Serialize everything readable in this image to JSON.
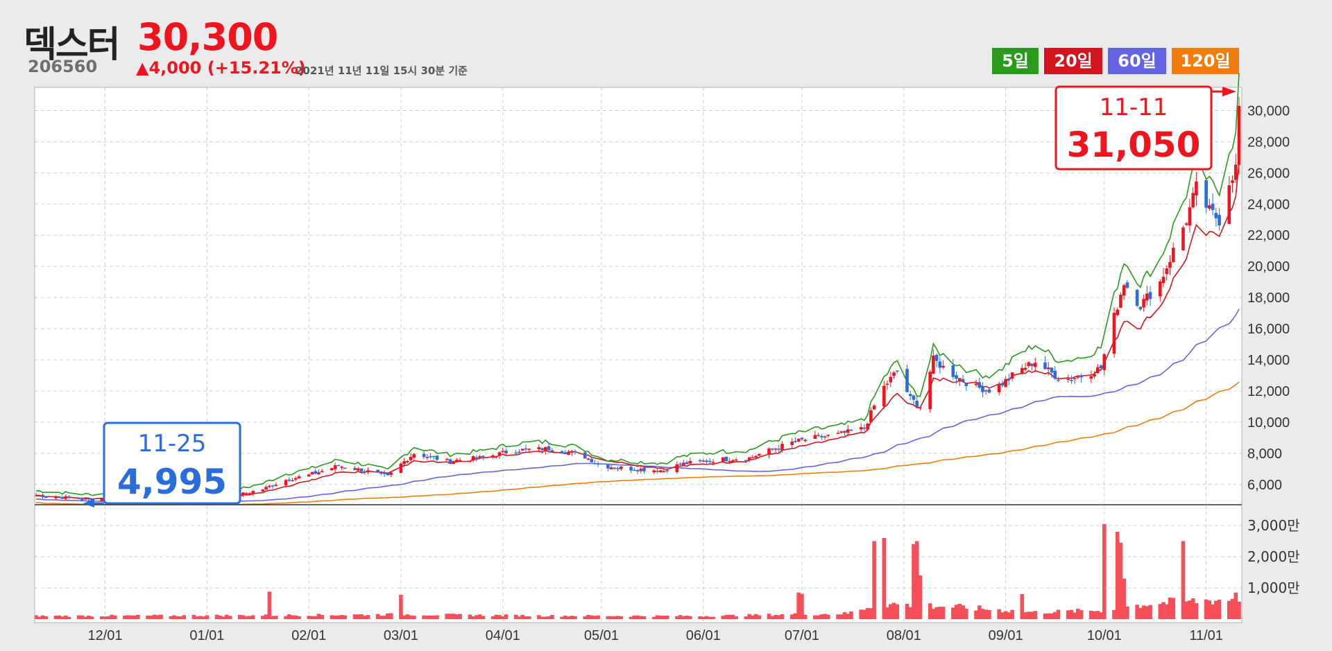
{
  "header": {
    "stock_name": "덱스터",
    "stock_code": "206560",
    "price": "30,300",
    "change": "▲4,000 (+15.21%)",
    "as_of": "2021년 11년 11일 15시 30분 기준"
  },
  "legend": [
    {
      "label": "5일",
      "color": "#2a9a1e"
    },
    {
      "label": "20일",
      "color": "#d4141e"
    },
    {
      "label": "60일",
      "color": "#6464e0"
    },
    {
      "label": "120일",
      "color": "#f07d0a"
    }
  ],
  "colors": {
    "up": "#f0141e",
    "down": "#2a6cdc",
    "volume": "#f5505a",
    "ma5": "#2a9a1e",
    "ma20": "#d4141e",
    "ma60": "#6464e0",
    "ma120": "#f07d0a"
  },
  "annotations": {
    "high": {
      "date": "11-11",
      "value": "31,050"
    },
    "low": {
      "date": "11-25",
      "value": "4,995"
    }
  },
  "chart_data": {
    "type": "candlestick",
    "price_axis": {
      "ticks": [
        6000,
        8000,
        10000,
        12000,
        14000,
        16000,
        18000,
        20000,
        22000,
        24000,
        26000,
        28000,
        30000
      ],
      "tick_labels": [
        "6,000",
        "8,000",
        "10,000",
        "12,000",
        "14,000",
        "16,000",
        "18,000",
        "20,000",
        "22,000",
        "24,000",
        "26,000",
        "28,000",
        "30,000"
      ],
      "range": [
        4700,
        31400
      ]
    },
    "volume_axis": {
      "ticks": [
        10000000,
        20000000,
        30000000
      ],
      "tick_labels": [
        "1,000만",
        "2,000만",
        "3,000만"
      ],
      "max": 34000000
    },
    "date_axis": {
      "start": "2020-11-10",
      "end": "2021-11-11",
      "ticks": [
        {
          "label": "12/01",
          "date": "2020-12-01"
        },
        {
          "label": "01/01",
          "date": "2021-01-01"
        },
        {
          "label": "02/01",
          "date": "2021-02-01"
        },
        {
          "label": "03/01",
          "date": "2021-03-01"
        },
        {
          "label": "04/01",
          "date": "2021-04-01"
        },
        {
          "label": "05/01",
          "date": "2021-05-01"
        },
        {
          "label": "06/01",
          "date": "2021-06-01"
        },
        {
          "label": "07/01",
          "date": "2021-07-01"
        },
        {
          "label": "08/01",
          "date": "2021-08-01"
        },
        {
          "label": "09/01",
          "date": "2021-09-01"
        },
        {
          "label": "10/01",
          "date": "2021-10-01"
        },
        {
          "label": "11/01",
          "date": "2021-11-01"
        }
      ]
    },
    "close_path": [
      [
        "2020-11-10",
        5300
      ],
      [
        "2020-11-25",
        5050
      ],
      [
        "2020-12-10",
        5150
      ],
      [
        "2020-12-28",
        5150
      ],
      [
        "2021-01-10",
        5300
      ],
      [
        "2021-01-18",
        5700
      ],
      [
        "2021-01-25",
        6300
      ],
      [
        "2021-02-01",
        6600
      ],
      [
        "2021-02-10",
        7200
      ],
      [
        "2021-02-20",
        6800
      ],
      [
        "2021-02-25",
        6500
      ],
      [
        "2021-03-01",
        7300
      ],
      [
        "2021-03-05",
        8000
      ],
      [
        "2021-03-15",
        7500
      ],
      [
        "2021-03-25",
        7700
      ],
      [
        "2021-04-05",
        8200
      ],
      [
        "2021-04-15",
        8300
      ],
      [
        "2021-04-25",
        7900
      ],
      [
        "2021-05-01",
        7200
      ],
      [
        "2021-05-10",
        7000
      ],
      [
        "2021-05-20",
        6900
      ],
      [
        "2021-05-25",
        7300
      ],
      [
        "2021-06-05",
        7600
      ],
      [
        "2021-06-15",
        7700
      ],
      [
        "2021-06-20",
        8100
      ],
      [
        "2021-06-28",
        8700
      ],
      [
        "2021-07-05",
        9000
      ],
      [
        "2021-07-12",
        9200
      ],
      [
        "2021-07-20",
        9600
      ],
      [
        "2021-07-25",
        12000
      ],
      [
        "2021-07-30",
        13300
      ],
      [
        "2021-08-03",
        11500
      ],
      [
        "2021-08-06",
        11000
      ],
      [
        "2021-08-10",
        14000
      ],
      [
        "2021-08-15",
        13200
      ],
      [
        "2021-08-22",
        12300
      ],
      [
        "2021-08-28",
        12000
      ],
      [
        "2021-09-05",
        13300
      ],
      [
        "2021-09-10",
        13900
      ],
      [
        "2021-09-18",
        12700
      ],
      [
        "2021-09-25",
        13000
      ],
      [
        "2021-09-30",
        13500
      ],
      [
        "2021-10-03",
        16000
      ],
      [
        "2021-10-07",
        19000
      ],
      [
        "2021-10-12",
        17500
      ],
      [
        "2021-10-18",
        19000
      ],
      [
        "2021-10-22",
        21000
      ],
      [
        "2021-10-26",
        23000
      ],
      [
        "2021-10-29",
        25000
      ],
      [
        "2021-11-02",
        23500
      ],
      [
        "2021-11-05",
        23000
      ],
      [
        "2021-11-08",
        25500
      ],
      [
        "2021-11-10",
        26300
      ],
      [
        "2021-11-11",
        30300
      ]
    ],
    "volume_path": [
      [
        "2020-11-10",
        1000000
      ],
      [
        "2021-01-18",
        1200000
      ],
      [
        "2021-03-01",
        1500000
      ],
      [
        "2021-04-10",
        1100000
      ],
      [
        "2021-06-01",
        1000000
      ],
      [
        "2021-07-15",
        1800000
      ],
      [
        "2021-07-24",
        5000000
      ],
      [
        "2021-08-15",
        4000000
      ],
      [
        "2021-09-10",
        2200000
      ],
      [
        "2021-09-30",
        2800000
      ],
      [
        "2021-10-15",
        5000000
      ],
      [
        "2021-11-11",
        6500000
      ]
    ],
    "volume_spikes": [
      [
        "2021-01-20",
        8800000
      ],
      [
        "2021-03-01",
        7800000
      ],
      [
        "2021-06-30",
        8500000
      ],
      [
        "2021-07-01",
        8100000
      ],
      [
        "2021-07-23",
        25000000
      ],
      [
        "2021-07-26",
        26000000
      ],
      [
        "2021-08-04",
        24000000
      ],
      [
        "2021-08-05",
        25000000
      ],
      [
        "2021-08-06",
        14000000
      ],
      [
        "2021-09-06",
        8000000
      ],
      [
        "2021-10-01",
        30500000
      ],
      [
        "2021-10-05",
        28000000
      ],
      [
        "2021-10-06",
        24500000
      ],
      [
        "2021-10-07",
        13000000
      ],
      [
        "2021-10-25",
        25000000
      ],
      [
        "2021-11-10",
        8500000
      ]
    ],
    "ma_offsets": {
      "ma5": [
        [
          "2020-11-10",
          0
        ],
        [
          "2021-07-20",
          400
        ],
        [
          "2021-10-20",
          2000
        ],
        [
          "2021-11-11",
          3000
        ]
      ],
      "ma60_factor": 0.88,
      "ma120_factor": 0.78
    }
  }
}
